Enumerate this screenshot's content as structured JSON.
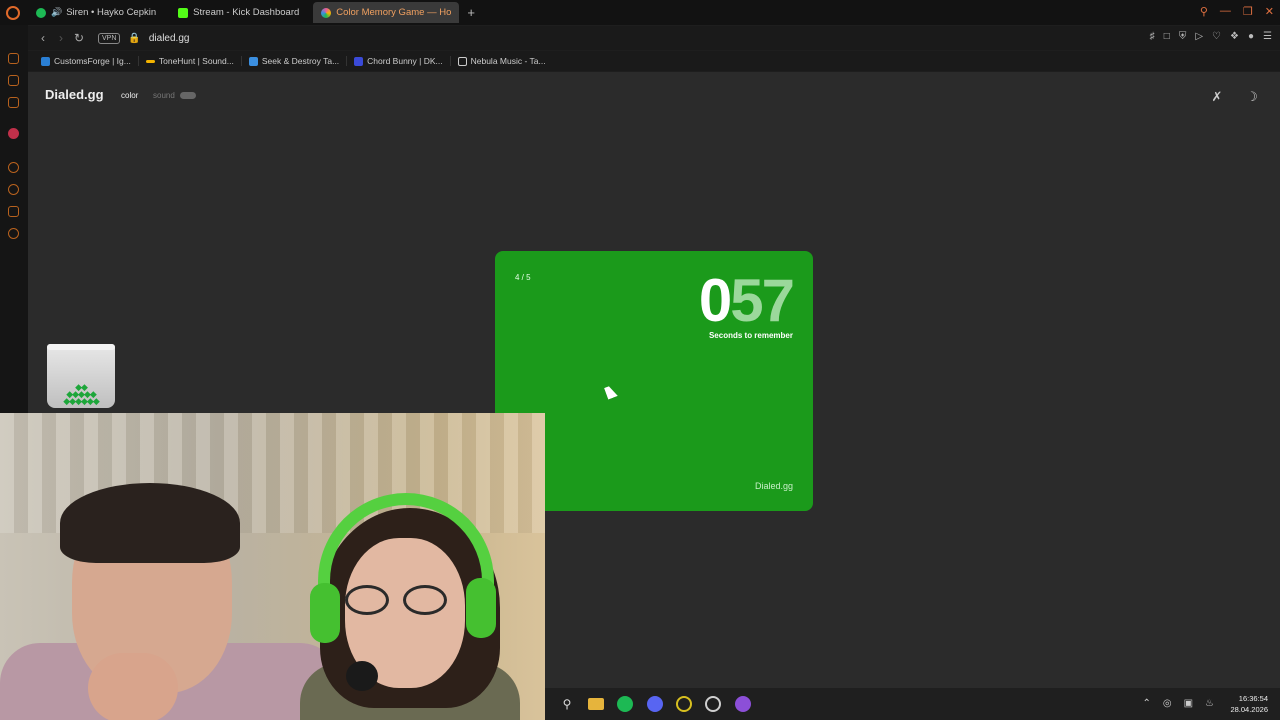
{
  "browser": {
    "tabs": [
      {
        "label": "Siren • Hayko Cepkin",
        "favicon_color": "#1db954",
        "playing": true
      },
      {
        "label": "Stream - Kick Dashboard",
        "favicon_color": "#53fc18"
      },
      {
        "label": "Color Memory Game — Ho",
        "favicon_color": "#e85d9c",
        "active": true
      }
    ],
    "new_tab_glyph": "+",
    "vpn_label": "VPN",
    "url": "dialed.gg",
    "bookmarks": [
      {
        "label": "CustomsForge | Ig...",
        "color": "#2a7fd4"
      },
      {
        "label": "ToneHunt | Sound...",
        "color": "#f4b400"
      },
      {
        "label": "Seek & Destroy Ta...",
        "color": "#3b8fe0"
      },
      {
        "label": "Chord Bunny | DK...",
        "color": "#3a4ad8"
      },
      {
        "label": "Nebula Music - Ta...",
        "color": "#cccccc"
      }
    ]
  },
  "site": {
    "brand": "Dialed.gg",
    "nav_color": "color",
    "nav_sound": "sound",
    "icons": [
      "pin-off-icon",
      "moon-icon"
    ]
  },
  "game": {
    "round": "4 / 5",
    "countdown_lead": "0",
    "countdown_rest": "57",
    "countdown_label": "Seconds to remember",
    "card_brand": "Dialed.gg",
    "card_color": "#1b9a1b"
  },
  "taskbar": {
    "icons": [
      "search-icon",
      "folder-icon",
      "spotify-icon",
      "discord-icon",
      "opera-icon",
      "obs-icon",
      "app-icon"
    ],
    "time": "16:36:54",
    "date": "28.04.2026"
  }
}
